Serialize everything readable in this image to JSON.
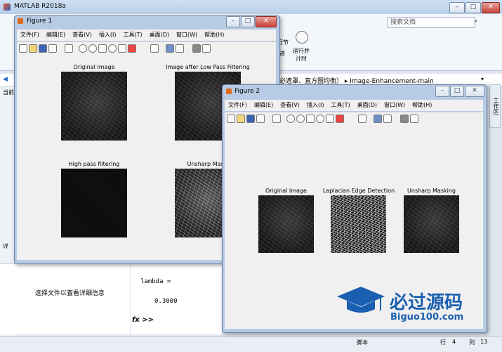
{
  "app": {
    "title": "MATLAB R2018a",
    "search_placeholder": "搜索文档",
    "ribbon_run_time": "运行并\n计时",
    "ribbon_section": "行节",
    "ribbon_section2": "进",
    "address_path": "必遮罩、直方图均衡）  ▸  Image-Enhancement-main",
    "workspace_tab": "工作区",
    "left_fragment_1": "当前",
    "left_fragment_2": "详",
    "detail_hint": "选择文件以查看详细信息",
    "command_lines": [
      "lambda =",
      "",
      "    0.3000"
    ],
    "prompt": "fx >>",
    "status_script": "脚本",
    "status_row_label": "行",
    "status_row": "4",
    "status_col_label": "列",
    "status_col": "13"
  },
  "figure1": {
    "title": "Figure 1",
    "menus": [
      "文件(F)",
      "编辑(E)",
      "查看(V)",
      "插入(I)",
      "工具(T)",
      "桌面(D)",
      "窗口(W)",
      "帮助(H)"
    ],
    "axes": [
      {
        "title": "Original Image"
      },
      {
        "title": "Image after Low Pass Filtering"
      },
      {
        "title": "High pass filtering"
      },
      {
        "title": "Unsharp Maski"
      }
    ]
  },
  "figure2": {
    "title": "Figure 2",
    "menus": [
      "文件(F)",
      "编辑(E)",
      "查看(V)",
      "插入(I)",
      "工具(T)",
      "桌面(D)",
      "窗口(W)",
      "帮助(H)"
    ],
    "axes": [
      {
        "title": "Original Image"
      },
      {
        "title": "Laplacian Edge Detection"
      },
      {
        "title": "Unsharp Masking"
      }
    ]
  },
  "watermark": {
    "text": "必过源码",
    "url": "Biguo100.com"
  },
  "colors": {
    "titlebar": "#b9cfe9",
    "figure_frame": "#b7cbe4",
    "figure_body": "#f0f0f0",
    "watermark": "#1a5fb0"
  }
}
